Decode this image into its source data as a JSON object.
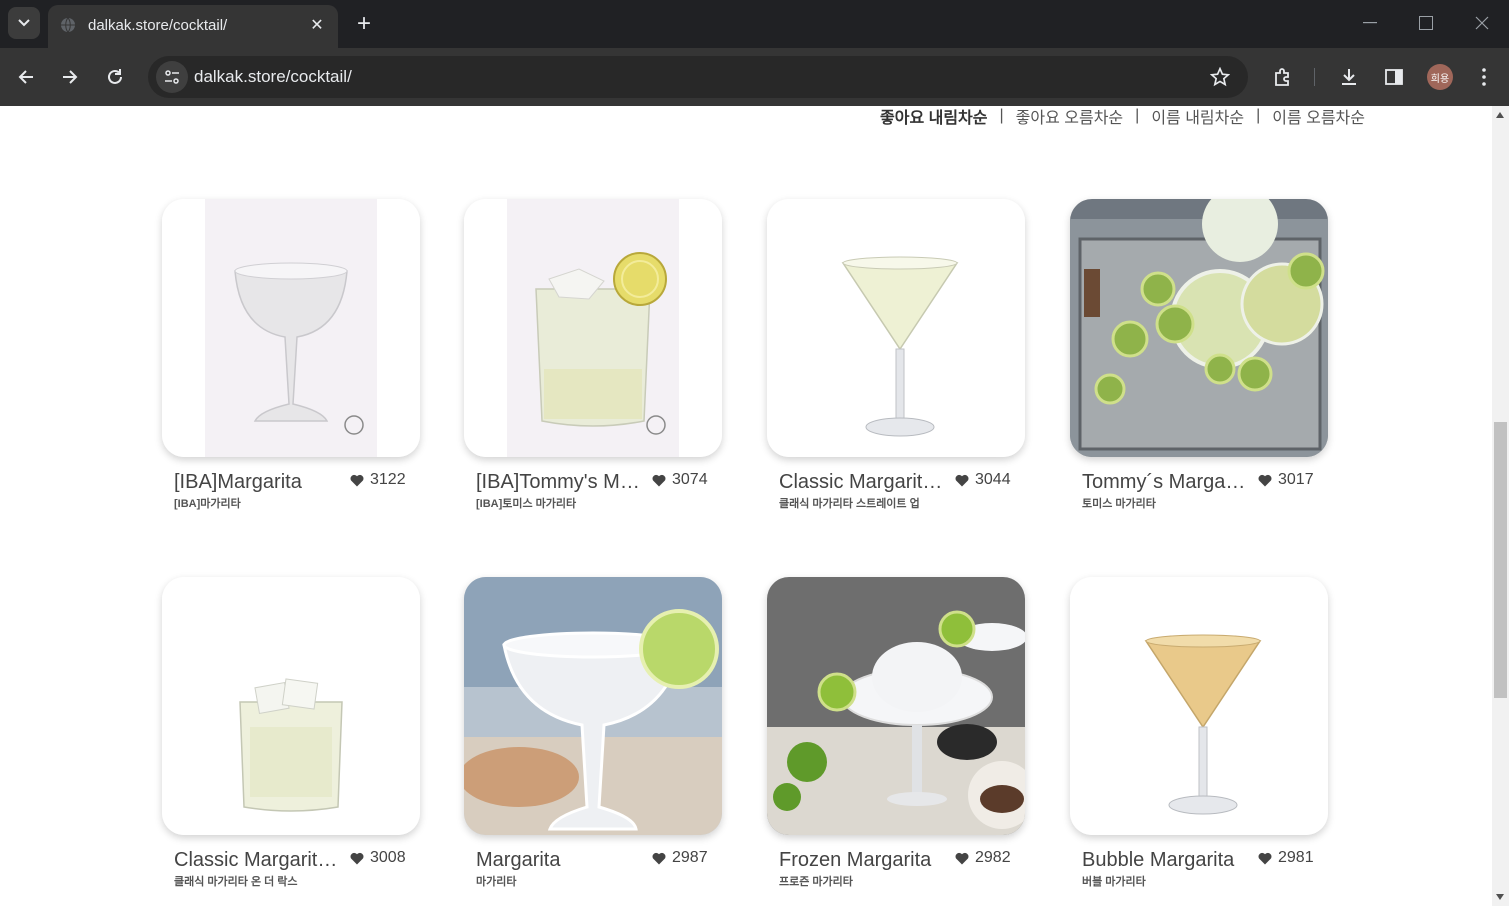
{
  "browser": {
    "tab_title": "dalkak.store/cocktail/",
    "url": "dalkak.store/cocktail/",
    "profile_initials": "희용"
  },
  "sort": {
    "options": [
      {
        "label": "좋아요 내림차순",
        "active": true
      },
      {
        "label": "좋아요 오름차순",
        "active": false
      },
      {
        "label": "이름 내림차순",
        "active": false
      },
      {
        "label": "이름 오름차순",
        "active": false
      }
    ],
    "separator": "|"
  },
  "cocktails": [
    {
      "name": "[IBA]Margarita",
      "korean": "[IBA]마가리타",
      "likes": "3122"
    },
    {
      "name": "[IBA]Tommy's Margarita",
      "korean": "[IBA]토미스 마가리타",
      "likes": "3074"
    },
    {
      "name": "Classic Margarita Straight Up",
      "korean": "클래식 마가리타 스트레이트 업",
      "likes": "3044"
    },
    {
      "name": "Tommy´s Margarita",
      "korean": "토미스 마가리타",
      "likes": "3017"
    },
    {
      "name": "Classic Margarita On The Rocks",
      "korean": "클래식 마가리타 온 더 락스",
      "likes": "3008"
    },
    {
      "name": "Margarita",
      "korean": "마가리타",
      "likes": "2987"
    },
    {
      "name": "Frozen Margarita",
      "korean": "프로즌 마가리타",
      "likes": "2982"
    },
    {
      "name": "Bubble Margarita",
      "korean": "버블 마가리타",
      "likes": "2981"
    }
  ]
}
